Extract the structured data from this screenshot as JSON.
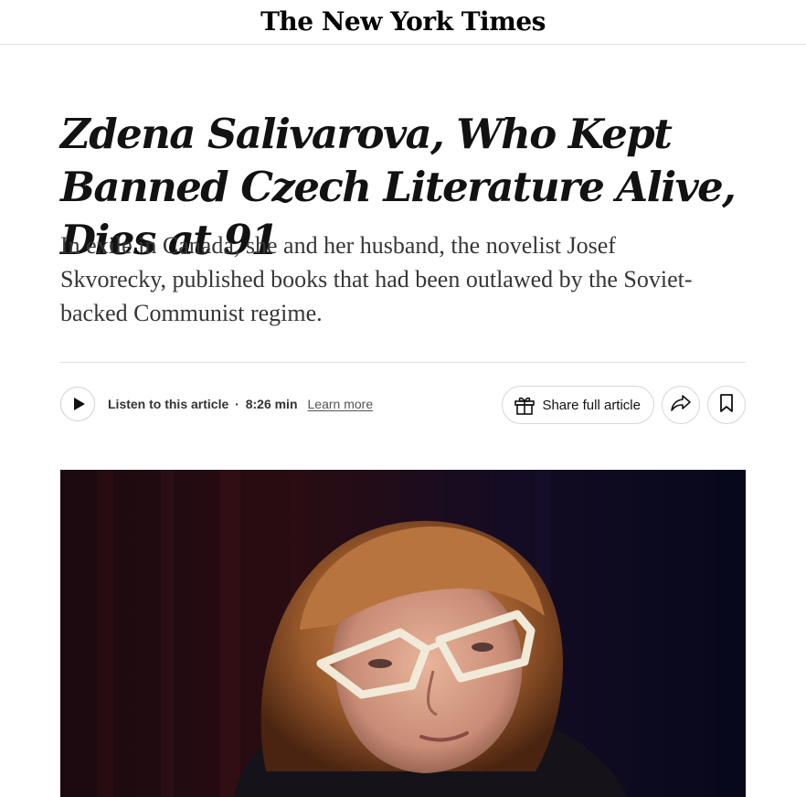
{
  "masthead": {
    "logo": "The New York Times"
  },
  "article": {
    "headline": "Zdena Salivarova, Who Kept Banned Czech Literature Alive, Dies at 91",
    "summary": "In exile in Canada, she and her husband, the novelist Josef Skvorecky, published books that had been outlawed by the Soviet-backed Communist regime."
  },
  "audio": {
    "listen_label": "Listen to this article",
    "separator": "·",
    "duration": "8:26 min",
    "learn_more": "Learn more"
  },
  "actions": {
    "share_full_article": "Share full article"
  },
  "icons": {
    "play": "play-icon",
    "gift": "gift-icon",
    "share": "share-arrow-icon",
    "bookmark": "bookmark-icon"
  }
}
